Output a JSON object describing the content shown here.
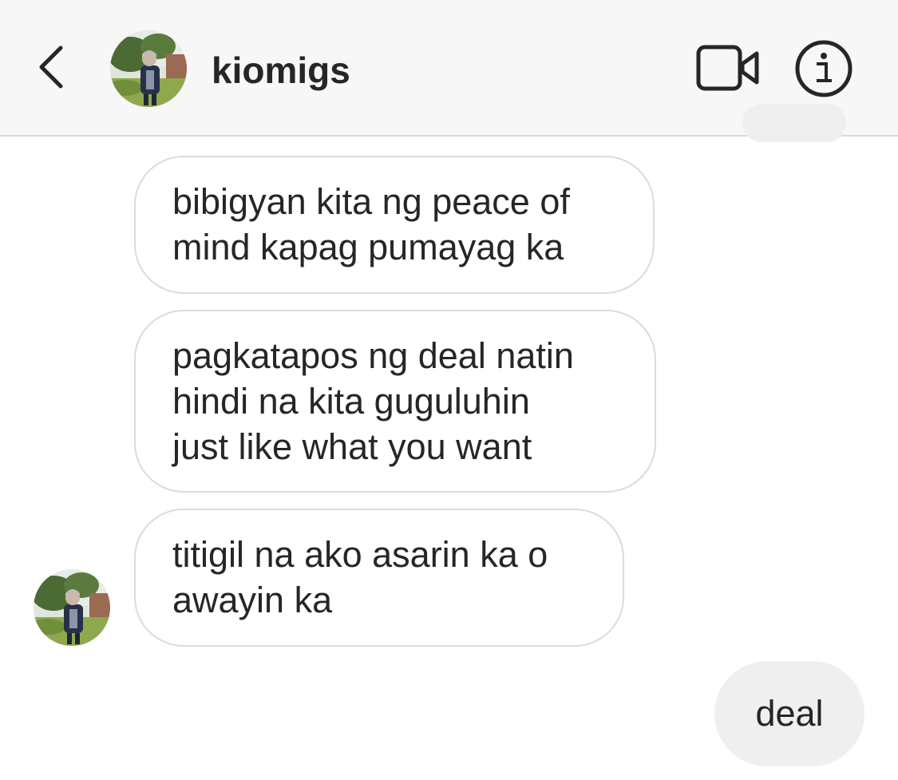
{
  "header": {
    "username": "kiomigs"
  },
  "icons": {
    "back": "chevron-left-icon",
    "video": "video-camera-icon",
    "info": "info-icon"
  },
  "messages": [
    {
      "from": "kiomigs",
      "text": "bibigyan kita ng peace of\nmind kapag pumayag ka"
    },
    {
      "from": "kiomigs",
      "text": "pagkatapos ng deal natin\nhindi na kita guguluhin\njust like what you want"
    },
    {
      "from": "kiomigs",
      "text": "titigil na ako asarin ka o\nawayin ka"
    },
    {
      "from": "me",
      "text": "deal"
    }
  ],
  "colors": {
    "header_bg": "#f7f7f7",
    "received_border": "#dbdbdb",
    "sent_bg": "#efefef",
    "text": "#262626"
  }
}
